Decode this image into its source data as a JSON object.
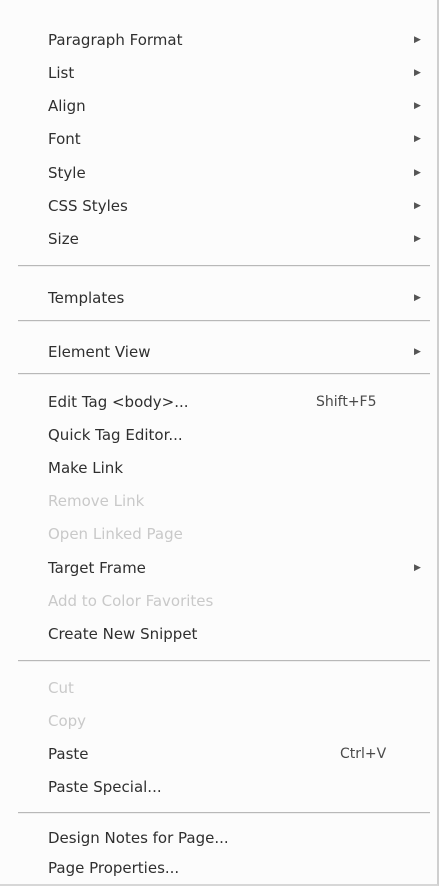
{
  "menu": {
    "items": [
      {
        "label": "Paragraph Format",
        "submenu": true,
        "disabled": false,
        "arrow": "▶"
      },
      {
        "label": "List",
        "submenu": true,
        "disabled": false,
        "arrow": "▶"
      },
      {
        "label": "Align",
        "submenu": true,
        "disabled": false,
        "arrow": "▶"
      },
      {
        "label": "Font",
        "submenu": true,
        "disabled": false,
        "arrow": "▶"
      },
      {
        "label": "Style",
        "submenu": true,
        "disabled": false,
        "arrow": "▶"
      },
      {
        "label": "CSS Styles",
        "submenu": true,
        "disabled": false,
        "arrow": "▶"
      },
      {
        "label": "Size",
        "submenu": true,
        "disabled": false,
        "arrow": "▶"
      },
      {
        "label": "Templates",
        "submenu": true,
        "disabled": false,
        "arrow": "▶"
      },
      {
        "label": "Element View",
        "submenu": true,
        "disabled": false,
        "arrow": "▶"
      },
      {
        "label": "Edit Tag <body>...",
        "shortcut": "Shift+F5",
        "disabled": false
      },
      {
        "label": "Quick Tag Editor...",
        "disabled": false
      },
      {
        "label": "Make Link",
        "disabled": false
      },
      {
        "label": "Remove Link",
        "disabled": true
      },
      {
        "label": "Open Linked Page",
        "disabled": true
      },
      {
        "label": "Target Frame",
        "submenu": true,
        "disabled": false,
        "arrow": "▶"
      },
      {
        "label": "Add to Color Favorites",
        "disabled": true
      },
      {
        "label": "Create New Snippet",
        "disabled": false
      },
      {
        "label": "Cut",
        "disabled": true
      },
      {
        "label": "Copy",
        "disabled": true
      },
      {
        "label": "Paste",
        "shortcut": "Ctrl+V",
        "disabled": false
      },
      {
        "label": "Paste Special...",
        "disabled": false
      },
      {
        "label": "Design Notes for Page...",
        "disabled": false
      },
      {
        "label": "Page Properties...",
        "disabled": false
      }
    ]
  }
}
